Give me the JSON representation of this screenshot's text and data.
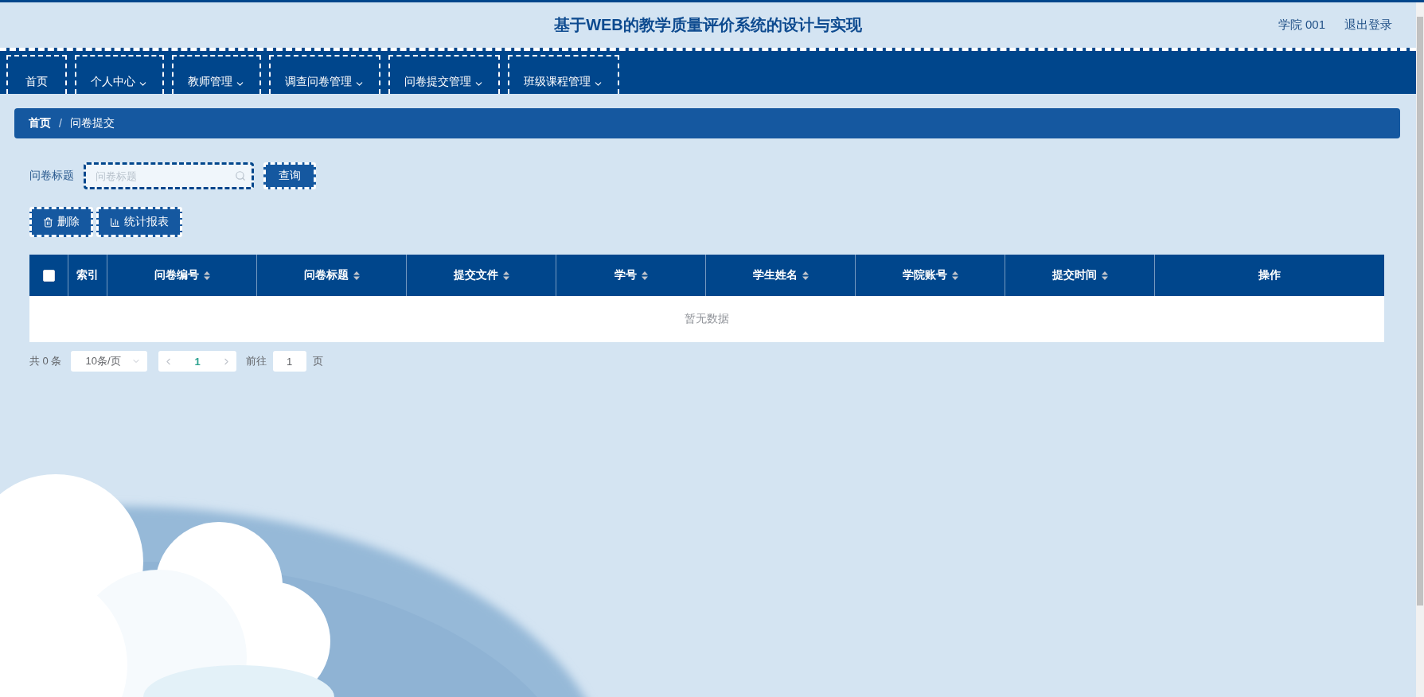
{
  "header": {
    "title": "基于WEB的教学质量评价系统的设计与实现",
    "user": "学院 001",
    "logout": "退出登录"
  },
  "nav": [
    {
      "label": "首页",
      "dropdown": false
    },
    {
      "label": "个人中心",
      "dropdown": true
    },
    {
      "label": "教师管理",
      "dropdown": true
    },
    {
      "label": "调查问卷管理",
      "dropdown": true
    },
    {
      "label": "问卷提交管理",
      "dropdown": true
    },
    {
      "label": "班级课程管理",
      "dropdown": true
    }
  ],
  "breadcrumb": {
    "separator": "/",
    "items": [
      {
        "label": "首页",
        "current": false
      },
      {
        "label": "问卷提交",
        "current": true
      }
    ]
  },
  "search": {
    "label": "问卷标题",
    "placeholder": "问卷标题",
    "button": "查询"
  },
  "actions": [
    {
      "label": "删除",
      "kind": "delete"
    },
    {
      "label": "统计报表",
      "kind": "report"
    }
  ],
  "table": {
    "select_all": {
      "checked": false
    },
    "columns": [
      {
        "label": "索引",
        "sortable": false
      },
      {
        "label": "问卷编号",
        "sortable": true
      },
      {
        "label": "问卷标题",
        "sortable": true
      },
      {
        "label": "提交文件",
        "sortable": true
      },
      {
        "label": "学号",
        "sortable": true
      },
      {
        "label": "学生姓名",
        "sortable": true
      },
      {
        "label": "学院账号",
        "sortable": true
      },
      {
        "label": "提交时间",
        "sortable": true
      },
      {
        "label": "操作",
        "sortable": false
      }
    ],
    "empty_text": "暂无数据"
  },
  "pagination": {
    "total": "共 0 条",
    "page_size": "10条/页",
    "pages": [
      {
        "label": "1",
        "selected": true
      }
    ],
    "goto_label": "前往",
    "goto_value": "1",
    "goto_suffix": "页"
  }
}
